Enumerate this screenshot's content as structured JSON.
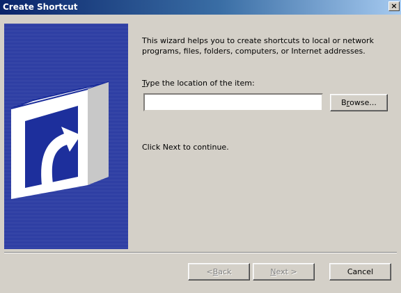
{
  "window": {
    "title": "Create Shortcut",
    "close_label": "×"
  },
  "main": {
    "intro": "This wizard helps you to create shortcuts to local or network programs, files, folders, computers, or Internet addresses.",
    "location_label_accel": "T",
    "location_label_rest": "ype the location of the item:",
    "location_value": "",
    "browse_accel_pre": "B",
    "browse_accel": "r",
    "browse_rest": "owse...",
    "next_hint": "Click Next to continue."
  },
  "footer": {
    "back_pre": "< ",
    "back_accel": "B",
    "back_rest": "ack",
    "next_accel": "N",
    "next_rest": "ext >",
    "cancel_label": "Cancel"
  },
  "icons": {
    "banner": "shortcut-arrow-icon",
    "close": "close-icon"
  },
  "colors": {
    "banner_blue": "#1d2f9c",
    "titlebar_start": "#0a246a",
    "titlebar_end": "#a6caf0",
    "face": "#d4d0c8"
  }
}
